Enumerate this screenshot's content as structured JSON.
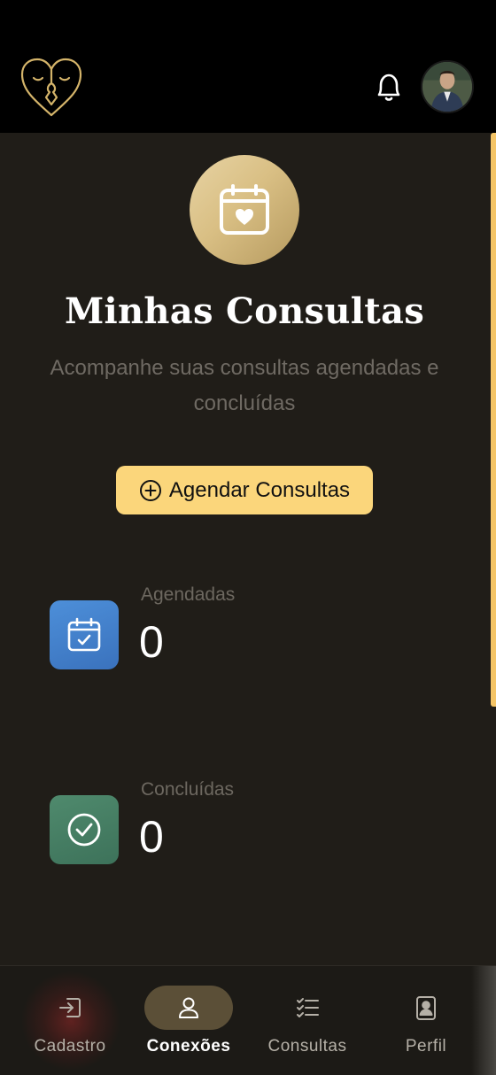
{
  "header": {
    "logo_icon": "heart-face-logo-icon",
    "notification_icon": "bell-icon",
    "avatar_icon": "user-avatar"
  },
  "hero": {
    "icon": "calendar-heart-icon",
    "title": "Minhas Consultas",
    "subtitle": "Acompanhe suas consultas agendadas e concluídas"
  },
  "actions": {
    "schedule_label": "Agendar Consultas",
    "schedule_icon": "plus-circle-icon"
  },
  "stats": [
    {
      "label": "Agendadas",
      "value": "0",
      "icon": "calendar-check-icon",
      "color": "#4a86d0"
    },
    {
      "label": "Concluídas",
      "value": "0",
      "icon": "check-circle-icon",
      "color": "#4a8367"
    }
  ],
  "nav": {
    "items": [
      {
        "label": "Cadastro",
        "icon": "login-icon",
        "active": false
      },
      {
        "label": "Conexões",
        "icon": "user-icon",
        "active": true
      },
      {
        "label": "Consultas",
        "icon": "checklist-icon",
        "active": false
      },
      {
        "label": "Perfil",
        "icon": "profile-card-icon",
        "active": false
      }
    ]
  },
  "colors": {
    "accent": "#fbd67b",
    "background": "#201d18",
    "header": "#000000",
    "gold": "#d4b46a"
  }
}
